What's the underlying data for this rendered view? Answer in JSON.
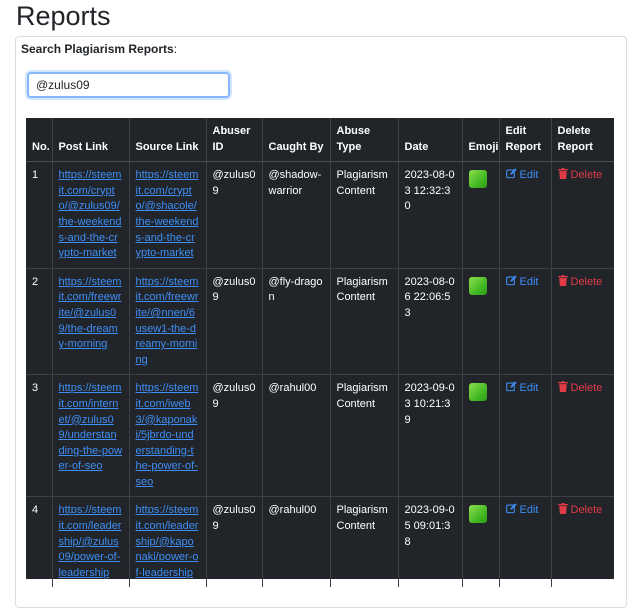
{
  "page": {
    "title": "Reports"
  },
  "search": {
    "label": "Search Plagiarism Reports",
    "label_suffix": ":",
    "value": "@zulus09"
  },
  "table": {
    "headers": [
      "No.",
      "Post Link",
      "Source Link",
      "Abuser ID",
      "Caught By",
      "Abuse Type",
      "Date",
      "Emoji",
      "Edit Report",
      "Delete Report"
    ],
    "edit_label": "Edit",
    "delete_label": "Delete",
    "rows": [
      {
        "no": "1",
        "post_link": "https://steemit.com/crypto/@zulus09/the-weekends-and-the-crypto-market",
        "source_link": "https://steemit.com/crypto/@shacole/the-weekends-and-the-crypto-market",
        "abuser": "@zulus09",
        "caught_by": "@shadow-warrior",
        "abuse_type": "Plagiarism Content",
        "date": "2023-08-03 12:32:30"
      },
      {
        "no": "2",
        "post_link": "https://steemit.com/freewrite/@zulus09/the-dreamy-morning",
        "source_link": "https://steemit.com/freewrite/@nnen/6usew1-the-dreamy-morning",
        "abuser": "@zulus09",
        "caught_by": "@fly-dragon",
        "abuse_type": "Plagiarism Content",
        "date": "2023-08-06 22:06:53"
      },
      {
        "no": "3",
        "post_link": "https://steemit.com/internet/@zulus09/understanding-the-power-of-seo",
        "source_link": "https://steemit.com/iweb3/@kaponaki/5jbrdo-understanding-the-power-of-seo",
        "abuser": "@zulus09",
        "caught_by": "@rahul00",
        "abuse_type": "Plagiarism Content",
        "date": "2023-09-03 10:21:39"
      },
      {
        "no": "4",
        "post_link": "https://steemit.com/leadership/@zulus09/power-of-leadership",
        "source_link": "https://steemit.com/leadership/@kaponaki/power-of-leadership",
        "abuser": "@zulus09",
        "caught_by": "@rahul00",
        "abuse_type": "Plagiarism Content",
        "date": "2023-09-05 09:01:38"
      }
    ]
  }
}
